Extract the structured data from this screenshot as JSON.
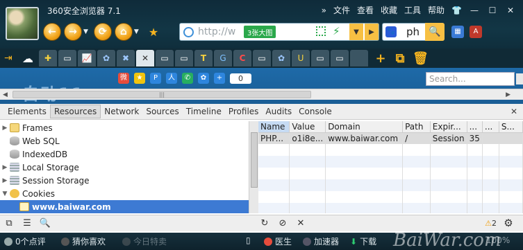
{
  "browser": {
    "title": "360安全浏览器 7.1",
    "menu": [
      "文件",
      "查看",
      "收藏",
      "工具",
      "帮助"
    ],
    "url_placeholder": "http://w",
    "url_badge": "3张大图",
    "search_text": "ph"
  },
  "tabs": {
    "icons": [
      "plugin-icon",
      "page-icon",
      "chart-icon",
      "paw-icon",
      "tool-icon",
      "close-icon",
      "page-icon",
      "page-icon",
      "t-icon",
      "g-icon",
      "c-icon",
      "page-icon",
      "paw-icon",
      "u-icon",
      "page-icon",
      "page-icon",
      "page-icon"
    ]
  },
  "page": {
    "heading": "自动11",
    "share_count": "0",
    "search_placeholder": "Search..."
  },
  "devtools": {
    "tabs": [
      "Elements",
      "Resources",
      "Network",
      "Sources",
      "Timeline",
      "Profiles",
      "Audits",
      "Console"
    ],
    "active_tab": "Resources",
    "tree": [
      {
        "label": "Frames",
        "expander": "▶",
        "icon": "folder"
      },
      {
        "label": "Web SQL",
        "expander": "",
        "icon": "db"
      },
      {
        "label": "IndexedDB",
        "expander": "",
        "icon": "db"
      },
      {
        "label": "Local Storage",
        "expander": "▶",
        "icon": "grid"
      },
      {
        "label": "Session Storage",
        "expander": "▶",
        "icon": "grid"
      },
      {
        "label": "Cookies",
        "expander": "▼",
        "icon": "cookie"
      },
      {
        "label": "www.baiwar.com",
        "expander": "",
        "icon": "file",
        "selected": true
      }
    ],
    "columns": [
      "Name",
      "Value",
      "Domain",
      "Path",
      "Expir...",
      "...",
      "...",
      "S..."
    ],
    "rows": [
      [
        "PHP...",
        "o1i8e...",
        "www.baiwar.com",
        "/",
        "Session",
        "35",
        "",
        ""
      ]
    ],
    "warnings": "2"
  },
  "statusbar": {
    "comments": "0个点评",
    "guess": "猜你喜欢",
    "today": "今日特卖",
    "doctor": "医生",
    "accelerator": "加速器",
    "download": "下载",
    "zoom": "100%",
    "watermark": "BaiWar.com"
  },
  "colors": {
    "accent": "#f2a318",
    "selection": "#3d7ad3",
    "chrome": "#123645"
  }
}
